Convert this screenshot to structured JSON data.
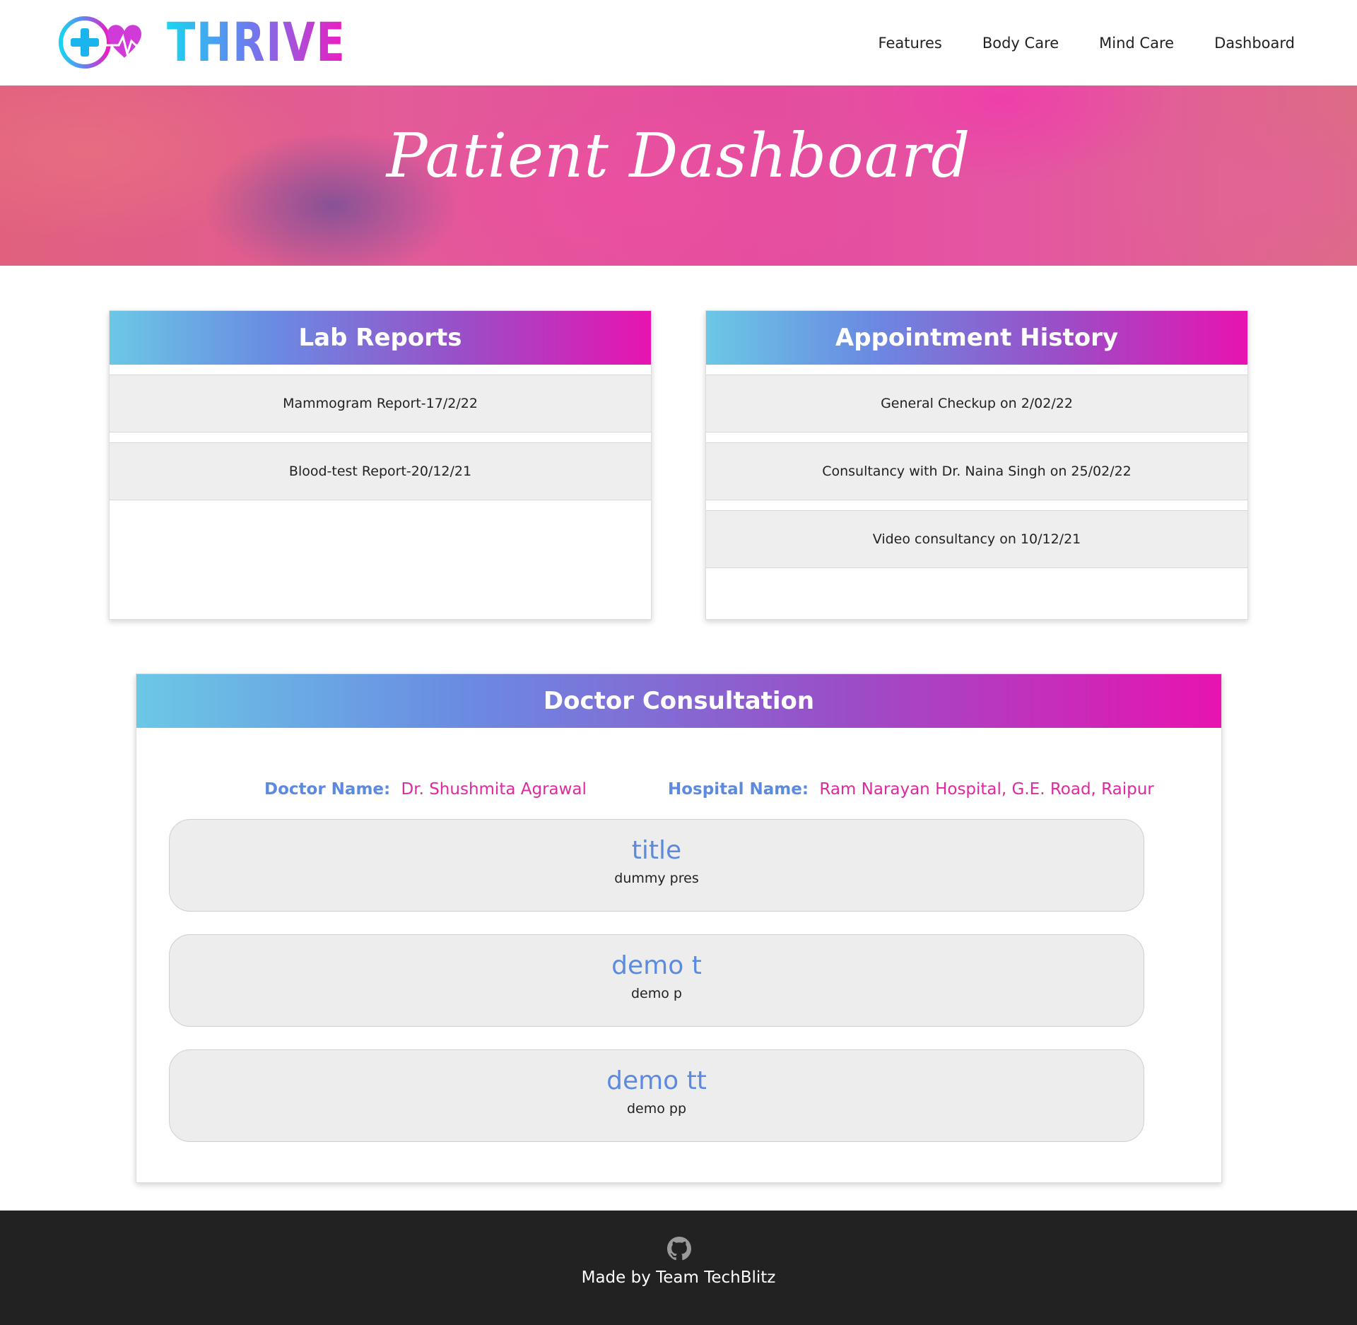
{
  "brand": {
    "name": "THRIVE"
  },
  "nav": {
    "items": [
      "Features",
      "Body Care",
      "Mind Care",
      "Dashboard"
    ]
  },
  "hero": {
    "title": "Patient Dashboard"
  },
  "lab_reports": {
    "title": "Lab Reports",
    "items": [
      "Mammogram Report-17/2/22",
      "Blood-test Report-20/12/21"
    ]
  },
  "appointment_history": {
    "title": "Appointment History",
    "items": [
      "General Checkup on 2/02/22",
      "Consultancy with Dr. Naina Singh on 25/02/22",
      "Video consultancy on 10/12/21"
    ]
  },
  "doctor_consultation": {
    "title": "Doctor Consultation",
    "doctor_label": "Doctor Name:",
    "doctor_value": "Dr. Shushmita Agrawal",
    "hospital_label": "Hospital Name:",
    "hospital_value": "Ram Narayan Hospital, G.E. Road, Raipur",
    "prescriptions": [
      {
        "title": "title",
        "body": "dummy pres"
      },
      {
        "title": "demo t",
        "body": "demo p"
      },
      {
        "title": "demo tt",
        "body": "demo pp"
      }
    ]
  },
  "footer": {
    "text": "Made by Team TechBlitz",
    "icon": "github-icon"
  },
  "colors": {
    "accent_blue": "#5c8ade",
    "accent_pink": "#e0299e",
    "footer_bg": "#222222"
  }
}
